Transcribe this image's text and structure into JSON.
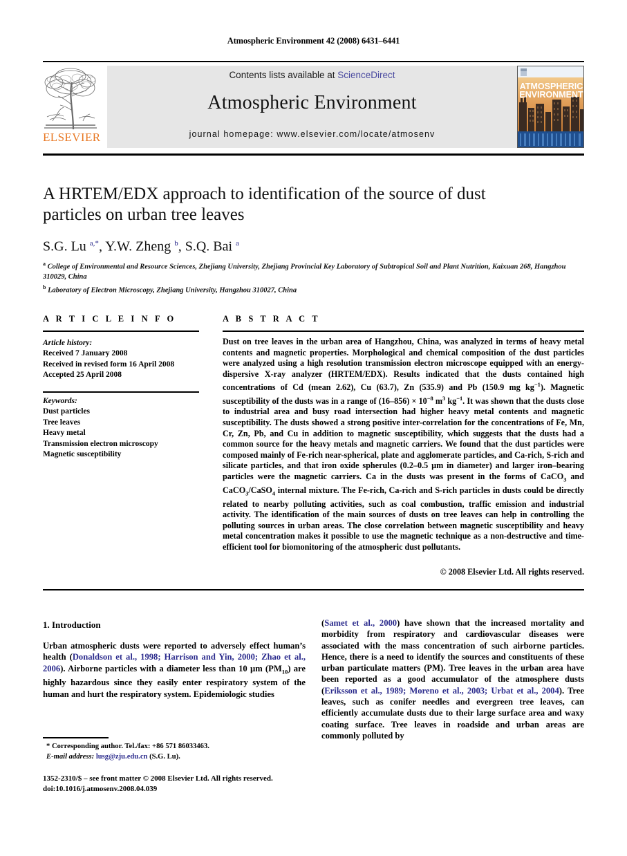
{
  "running_head": "Atmospheric Environment 42 (2008) 6431–6441",
  "banner": {
    "contents_prefix": "Contents lists available at ",
    "sciencedirect": "ScienceDirect",
    "journal_title": "Atmospheric Environment",
    "homepage": "journal homepage: www.elsevier.com/locate/atmosenv",
    "publisher_wordmark": "ELSEVIER",
    "cover_line1": "ATMOSPHERIC",
    "cover_line2": "ENVIRONMENT",
    "link_color": "#4a4aa0",
    "wordmark_color": "#E87722",
    "banner_bg": "#e6e6e6"
  },
  "article": {
    "title": "A HRTEM/EDX approach to identification of the source of dust particles on urban tree leaves",
    "authors_html": "S.G. Lu <sup>a,*</sup>, Y.W. Zheng <sup>b</sup>, S.Q. Bai <sup>a</sup>",
    "affiliation_a": "College of Environmental and Resource Sciences, Zhejiang University, Zhejiang Provincial Key Laboratory of Subtropical Soil and Plant Nutrition, Kaixuan 268, Hangzhou 310029, China",
    "affiliation_b": "Laboratory of Electron Microscopy, Zhejiang University, Hangzhou 310027, China"
  },
  "article_info": {
    "heading": "A R T I C L E  I N F O",
    "history_label": "Article history:",
    "received": "Received 7 January 2008",
    "revised": "Received in revised form 16 April 2008",
    "accepted": "Accepted 25 April 2008",
    "keywords_label": "Keywords:",
    "keywords": [
      "Dust particles",
      "Tree leaves",
      "Heavy metal",
      "Transmission electron microscopy",
      "Magnetic susceptibility"
    ]
  },
  "abstract": {
    "heading": "A B S T R A C T",
    "text_html": "Dust on tree leaves in the urban area of Hangzhou, China, was analyzed in terms of heavy metal contents and magnetic properties. Morphological and chemical composition of the dust particles were analyzed using a high resolution transmission electron microscope equipped with an energy-dispersive X-ray analyzer (HRTEM/EDX). Results indicated that the dusts contained high concentrations of Cd (mean 2.62), Cu (63.7), Zn (535.9) and Pb (150.9 mg kg<sup>&#8722;1</sup>). Magnetic susceptibility of the dusts was in a range of (16&#8211;856) &#215; 10<sup>&#8722;8</sup> m<sup>3</sup> kg<sup>&#8722;1</sup>. It was shown that the dusts close to industrial area and busy road intersection had higher heavy metal contents and magnetic susceptibility. The dusts showed a strong positive inter-correlation for the concentrations of Fe, Mn, Cr, Zn, Pb, and Cu in addition to magnetic susceptibility, which suggests that the dusts had a common source for the heavy metals and magnetic carriers. We found that the dust particles were composed mainly of Fe-rich near-spherical, plate and agglomerate particles, and Ca-rich, S-rich and silicate particles, and that iron oxide spherules (0.2&#8211;0.5 &#181;m in diameter) and larger iron&#8211;bearing particles were the magnetic carriers. Ca in the dusts was present in the forms of CaCO<sub>3</sub> and CaCO<sub>3</sub>/CaSO<sub>4</sub> internal mixture. The Fe-rich, Ca-rich and S-rich particles in dusts could be directly related to nearby polluting activities, such as coal combustion, traffic emission and industrial activity. The identification of the main sources of dusts on tree leaves can help in controlling the polluting sources in urban areas. The close correlation between magnetic susceptibility and heavy metal concentration makes it possible to use the magnetic technique as a non-destructive and time-efficient tool for biomonitoring of the atmospheric dust pollutants.",
    "copyright": "© 2008 Elsevier Ltd. All rights reserved."
  },
  "body": {
    "section_title": "1.  Introduction",
    "left_column_html": "Urban atmospheric dusts were reported to adversely effect human&#8217;s health (<span class=\"cite\">Donaldson et al., 1998; Harrison and Yin, 2000; Zhao et al., 2006</span>). Airborne particles with a diameter less than 10 &#181;m (PM<sub>10</sub>) are highly hazardous since they easily enter respiratory system of the human and hurt the respiratory system. Epidemiologic studies",
    "right_column_html": "(<span class=\"cite\">Samet et al., 2000</span>) have shown that the increased mortality and morbidity from respiratory and cardiovascular diseases were associated with the mass concentration of such airborne particles. Hence, there is a need to identify the sources and constituents of these urban particulate matters (PM). Tree leaves in the urban area have been reported as a good accumulator of the atmosphere dusts (<span class=\"cite\">Eriksson et al., 1989; Moreno et al., 2003; Urbat et al., 2004</span>). Tree leaves, such as conifer needles and evergreen tree leaves, can efficiently accumulate dusts due to their large surface area and waxy coating surface. Tree leaves in roadside and urban areas are commonly polluted by"
  },
  "footnote": {
    "corresponding": "* Corresponding author. Tel./fax: +86 571 86033463.",
    "email_label": "E-mail address:",
    "email": "lusg@zju.edu.cn",
    "email_suffix": "(S.G. Lu)."
  },
  "imprint": {
    "line1": "1352-2310/$ – see front matter © 2008 Elsevier Ltd. All rights reserved.",
    "line2": "doi:10.1016/j.atmosenv.2008.04.039"
  }
}
